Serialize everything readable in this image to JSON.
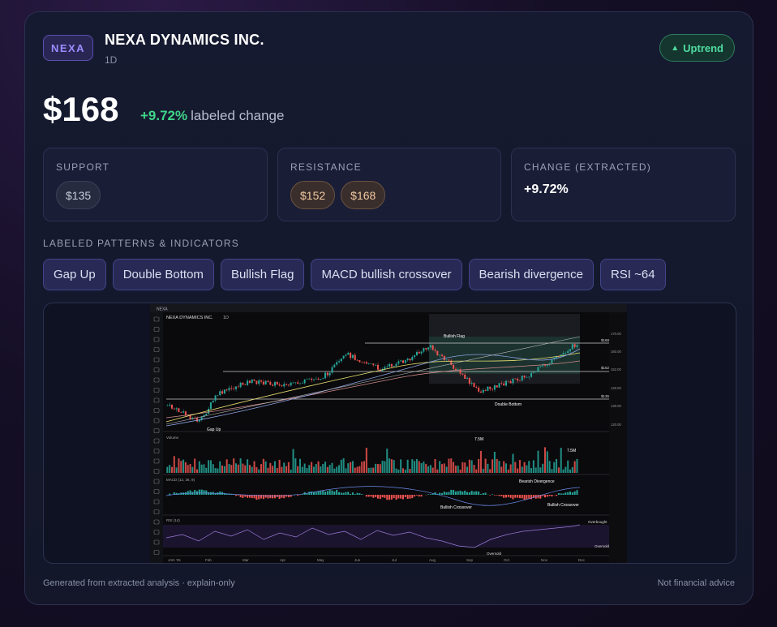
{
  "header": {
    "ticker": "NEXA",
    "company": "NEXA DYNAMICS INC.",
    "timeframe": "1D",
    "trend_label": "Uptrend",
    "trend_icon": "triangle-up-icon"
  },
  "price": {
    "value": "$168",
    "change": "+9.72%",
    "change_label": "labeled change"
  },
  "metrics": {
    "support": {
      "label": "SUPPORT",
      "values": [
        "$135"
      ]
    },
    "resistance": {
      "label": "RESISTANCE",
      "values": [
        "$152",
        "$168"
      ]
    },
    "change": {
      "label": "CHANGE (EXTRACTED)",
      "value": "+9.72%"
    }
  },
  "patterns": {
    "label": "LABELED PATTERNS & INDICATORS",
    "items": [
      "Gap Up",
      "Double Bottom",
      "Bullish Flag",
      "MACD bullish crossover",
      "Bearish divergence",
      "RSI ~64"
    ]
  },
  "chart_image": {
    "title": "NEXA DYNAMICS INC.",
    "timeframe": "1D",
    "annotations": [
      "Bullish Flag",
      "Double Bottom",
      "Gap Up",
      "Bearish Divergence",
      "Bullish Crossover",
      "Bullish Crossover",
      "Overbought",
      "Oversold",
      "Oversold"
    ],
    "price_levels": [
      "$168",
      "$152",
      "$135"
    ],
    "y_ticks": [
      "170.00",
      "160.00",
      "152.00",
      "140.00",
      "130.00",
      "120.00"
    ],
    "volume_labels": [
      "7.5M",
      "7.5M"
    ],
    "months": [
      "JAN '25",
      "Feb",
      "Mar",
      "Apr",
      "May",
      "Jun",
      "Jul",
      "Aug",
      "Sep",
      "Oct",
      "Nov",
      "Dec"
    ],
    "pane_labels": {
      "volume": "Volume",
      "macd": "MACD (12, 26, 9)",
      "rsi": "RSI (14)"
    }
  },
  "footer": {
    "left": "Generated from extracted analysis · explain-only",
    "right": "Not financial advice"
  },
  "colors": {
    "accent": "#9b8cff",
    "positive": "#3fd489",
    "resistance": "#f0c8a0"
  }
}
